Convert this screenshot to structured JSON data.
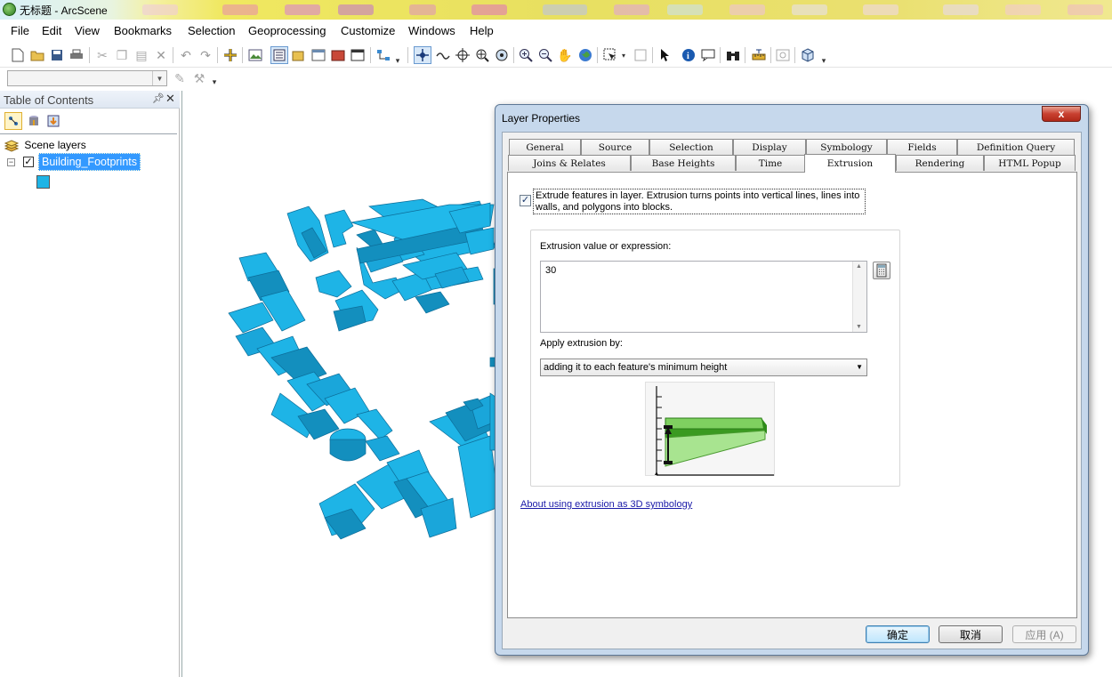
{
  "window": {
    "title": "无标题 - ArcScene"
  },
  "menu": [
    "File",
    "Edit",
    "View",
    "Bookmarks",
    "Selection",
    "Geoprocessing",
    "Customize",
    "Windows",
    "Help"
  ],
  "toc": {
    "title": "Table of Contents",
    "root_label": "Scene layers",
    "layer": {
      "name": "Building_Footprints",
      "checked": true,
      "color": "#1eb4e6"
    }
  },
  "scene": {
    "building_color": "#1eb4e6"
  },
  "dialog": {
    "title": "Layer Properties",
    "close_label": "x",
    "tabs_row1": [
      "General",
      "Source",
      "Selection",
      "Display",
      "Symbology",
      "Fields",
      "Definition Query"
    ],
    "tabs_row2": [
      "Joins & Relates",
      "Base Heights",
      "Time",
      "Extrusion",
      "Rendering",
      "HTML Popup"
    ],
    "active_tab": "Extrusion",
    "extrude_checkbox": {
      "checked": true,
      "label": "Extrude features in layer.  Extrusion turns points into vertical lines, lines into walls, and polygons into blocks."
    },
    "expression_label": "Extrusion value or expression:",
    "expression_value": "30",
    "apply_label": "Apply extrusion by:",
    "apply_value": "adding it to each feature's minimum height",
    "help_link": "About using extrusion as 3D symbology",
    "buttons": {
      "ok": "确定",
      "cancel": "取消",
      "apply": "应用 (A)"
    }
  }
}
